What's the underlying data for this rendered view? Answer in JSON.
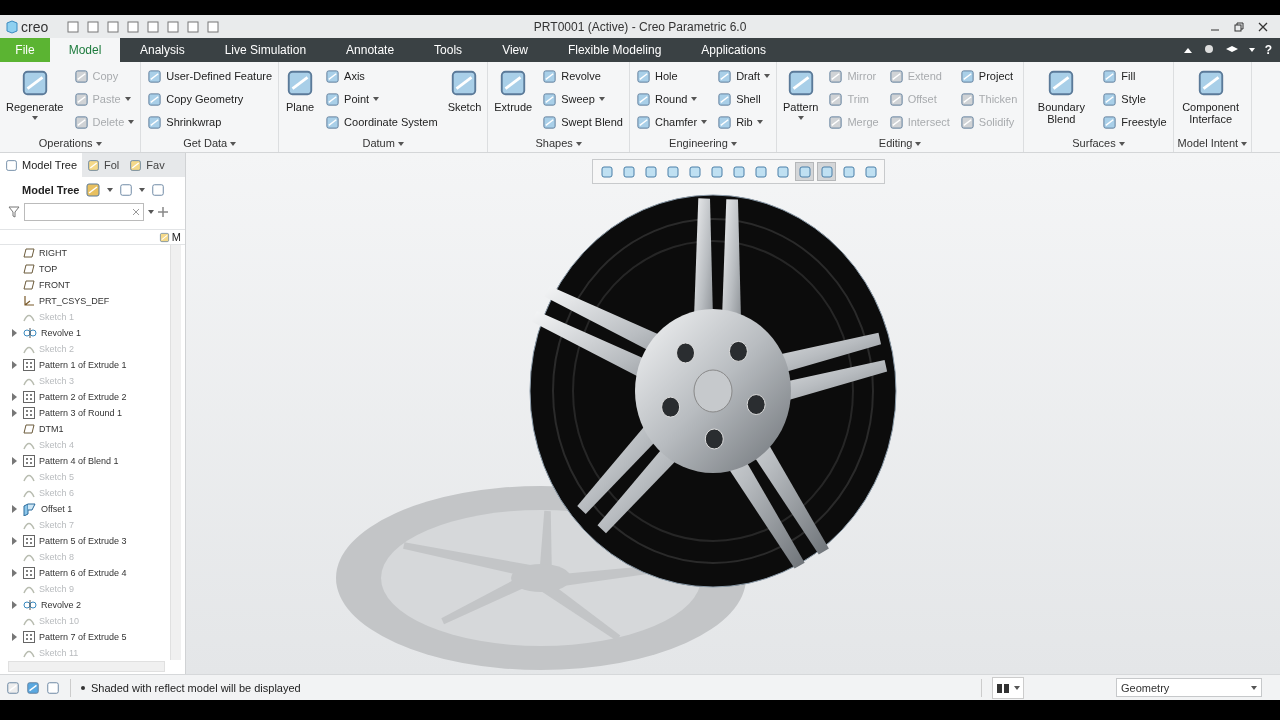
{
  "window": {
    "logo": "creo",
    "title": "PRT0001 (Active) - Creo Parametric 6.0"
  },
  "tabs": [
    {
      "label": "File",
      "kind": "file",
      "selected": false
    },
    {
      "label": "Model",
      "kind": "tab",
      "selected": true
    },
    {
      "label": "Analysis",
      "kind": "tab",
      "selected": false
    },
    {
      "label": "Live Simulation",
      "kind": "tab",
      "selected": false
    },
    {
      "label": "Annotate",
      "kind": "tab",
      "selected": false
    },
    {
      "label": "Tools",
      "kind": "tab",
      "selected": false
    },
    {
      "label": "View",
      "kind": "tab",
      "selected": false
    },
    {
      "label": "Flexible Modeling",
      "kind": "tab",
      "selected": false
    },
    {
      "label": "Applications",
      "kind": "tab",
      "selected": false
    }
  ],
  "help": "?",
  "ribbon": [
    {
      "title": "Operations",
      "columns": [
        [
          {
            "label": "Regenerate",
            "kind": "large",
            "disabled": false,
            "menu": true
          }
        ],
        [
          {
            "label": "Copy",
            "kind": "small",
            "disabled": true,
            "menu": false
          },
          {
            "label": "Paste",
            "kind": "small",
            "disabled": true,
            "menu": true
          },
          {
            "label": "Delete",
            "kind": "small",
            "disabled": true,
            "menu": true
          }
        ]
      ]
    },
    {
      "title": "Get Data",
      "columns": [
        [
          {
            "label": "User-Defined Feature",
            "kind": "small",
            "disabled": false,
            "menu": false
          },
          {
            "label": "Copy Geometry",
            "kind": "small",
            "disabled": false,
            "menu": false
          },
          {
            "label": "Shrinkwrap",
            "kind": "small",
            "disabled": false,
            "menu": false
          }
        ]
      ]
    },
    {
      "title": "Datum",
      "columns": [
        [
          {
            "label": "Plane",
            "kind": "large",
            "disabled": false,
            "menu": false
          }
        ],
        [
          {
            "label": "Axis",
            "kind": "small",
            "disabled": false,
            "menu": false
          },
          {
            "label": "Point",
            "kind": "small",
            "disabled": false,
            "menu": true
          },
          {
            "label": "Coordinate System",
            "kind": "small",
            "disabled": false,
            "menu": false
          }
        ],
        [
          {
            "label": "Sketch",
            "kind": "large",
            "disabled": false,
            "menu": false
          }
        ]
      ]
    },
    {
      "title": "Shapes",
      "columns": [
        [
          {
            "label": "Extrude",
            "kind": "large",
            "disabled": false,
            "menu": false
          }
        ],
        [
          {
            "label": "Revolve",
            "kind": "small",
            "disabled": false,
            "menu": false
          },
          {
            "label": "Sweep",
            "kind": "small",
            "disabled": false,
            "menu": true
          },
          {
            "label": "Swept Blend",
            "kind": "small",
            "disabled": false,
            "menu": false
          }
        ]
      ]
    },
    {
      "title": "Engineering",
      "columns": [
        [
          {
            "label": "Hole",
            "kind": "small",
            "disabled": false,
            "menu": false
          },
          {
            "label": "Round",
            "kind": "small",
            "disabled": false,
            "menu": true
          },
          {
            "label": "Chamfer",
            "kind": "small",
            "disabled": false,
            "menu": true
          }
        ],
        [
          {
            "label": "Draft",
            "kind": "small",
            "disabled": false,
            "menu": true
          },
          {
            "label": "Shell",
            "kind": "small",
            "disabled": false,
            "menu": false
          },
          {
            "label": "Rib",
            "kind": "small",
            "disabled": false,
            "menu": true
          }
        ]
      ]
    },
    {
      "title": "Editing",
      "columns": [
        [
          {
            "label": "Pattern",
            "kind": "large",
            "disabled": false,
            "menu": true
          }
        ],
        [
          {
            "label": "Mirror",
            "kind": "small",
            "disabled": true,
            "menu": false
          },
          {
            "label": "Trim",
            "kind": "small",
            "disabled": true,
            "menu": false
          },
          {
            "label": "Merge",
            "kind": "small",
            "disabled": true,
            "menu": false
          }
        ],
        [
          {
            "label": "Extend",
            "kind": "small",
            "disabled": true,
            "menu": false
          },
          {
            "label": "Offset",
            "kind": "small",
            "disabled": true,
            "menu": false
          },
          {
            "label": "Intersect",
            "kind": "small",
            "disabled": true,
            "menu": false
          }
        ],
        [
          {
            "label": "Project",
            "kind": "small",
            "disabled": false,
            "menu": false
          },
          {
            "label": "Thicken",
            "kind": "small",
            "disabled": true,
            "menu": false
          },
          {
            "label": "Solidify",
            "kind": "small",
            "disabled": true,
            "menu": false
          }
        ]
      ]
    },
    {
      "title": "Surfaces",
      "columns": [
        [
          {
            "label": "Boundary Blend",
            "kind": "large",
            "disabled": false,
            "menu": false
          }
        ],
        [
          {
            "label": "Fill",
            "kind": "small",
            "disabled": false,
            "menu": false
          },
          {
            "label": "Style",
            "kind": "small",
            "disabled": false,
            "menu": false
          },
          {
            "label": "Freestyle",
            "kind": "small",
            "disabled": false,
            "menu": false
          }
        ]
      ]
    },
    {
      "title": "Model Intent",
      "columns": [
        [
          {
            "label": "Component Interface",
            "kind": "large",
            "disabled": false,
            "menu": false
          }
        ]
      ]
    }
  ],
  "panel": {
    "tabs": [
      {
        "label": "Model Tree",
        "selected": true
      },
      {
        "label": "Fol",
        "selected": false
      },
      {
        "label": "Fav",
        "selected": false
      }
    ],
    "header": "Model Tree",
    "column_header": "M",
    "items": [
      {
        "label": "RIGHT",
        "kind": "plane",
        "expandable": false,
        "disabled": false
      },
      {
        "label": "TOP",
        "kind": "plane",
        "expandable": false,
        "disabled": false
      },
      {
        "label": "FRONT",
        "kind": "plane",
        "expandable": false,
        "disabled": false
      },
      {
        "label": "PRT_CSYS_DEF",
        "kind": "csys",
        "expandable": false,
        "disabled": false
      },
      {
        "label": "Sketch 1",
        "kind": "sketch",
        "expandable": false,
        "disabled": true
      },
      {
        "label": "Revolve 1",
        "kind": "revolve",
        "expandable": true,
        "disabled": false
      },
      {
        "label": "Sketch 2",
        "kind": "sketch",
        "expandable": false,
        "disabled": true
      },
      {
        "label": "Pattern 1 of Extrude 1",
        "kind": "pattern",
        "expandable": true,
        "disabled": false
      },
      {
        "label": "Sketch 3",
        "kind": "sketch",
        "expandable": false,
        "disabled": true
      },
      {
        "label": "Pattern 2 of Extrude 2",
        "kind": "pattern",
        "expandable": true,
        "disabled": false
      },
      {
        "label": "Pattern 3 of Round 1",
        "kind": "pattern",
        "expandable": true,
        "disabled": false
      },
      {
        "label": "DTM1",
        "kind": "plane",
        "expandable": false,
        "disabled": false
      },
      {
        "label": "Sketch 4",
        "kind": "sketch",
        "expandable": false,
        "disabled": true
      },
      {
        "label": "Pattern 4 of Blend 1",
        "kind": "pattern",
        "expandable": true,
        "disabled": false
      },
      {
        "label": "Sketch 5",
        "kind": "sketch",
        "expandable": false,
        "disabled": true
      },
      {
        "label": "Sketch 6",
        "kind": "sketch",
        "expandable": false,
        "disabled": true
      },
      {
        "label": "Offset 1",
        "kind": "offset",
        "expandable": true,
        "disabled": false
      },
      {
        "label": "Sketch 7",
        "kind": "sketch",
        "expandable": false,
        "disabled": true
      },
      {
        "label": "Pattern 5 of Extrude 3",
        "kind": "pattern",
        "expandable": true,
        "disabled": false
      },
      {
        "label": "Sketch 8",
        "kind": "sketch",
        "expandable": false,
        "disabled": true
      },
      {
        "label": "Pattern 6 of Extrude 4",
        "kind": "pattern",
        "expandable": true,
        "disabled": false
      },
      {
        "label": "Sketch 9",
        "kind": "sketch",
        "expandable": false,
        "disabled": true
      },
      {
        "label": "Revolve 2",
        "kind": "revolve",
        "expandable": true,
        "disabled": false
      },
      {
        "label": "Sketch 10",
        "kind": "sketch",
        "expandable": false,
        "disabled": true
      },
      {
        "label": "Pattern 7 of Extrude 5",
        "kind": "pattern",
        "expandable": true,
        "disabled": false
      },
      {
        "label": "Sketch 11",
        "kind": "sketch",
        "expandable": false,
        "disabled": true
      }
    ]
  },
  "view_toolbar": [
    {
      "selected": false
    },
    {
      "selected": false
    },
    {
      "selected": false
    },
    {
      "selected": false
    },
    {
      "selected": false
    },
    {
      "selected": false
    },
    {
      "selected": false
    },
    {
      "selected": false
    },
    {
      "selected": false
    },
    {
      "selected": true
    },
    {
      "selected": true
    },
    {
      "selected": false
    },
    {
      "selected": false
    }
  ],
  "status_bar": {
    "message": "Shaded with reflect model will be displayed",
    "filter": "Geometry"
  }
}
